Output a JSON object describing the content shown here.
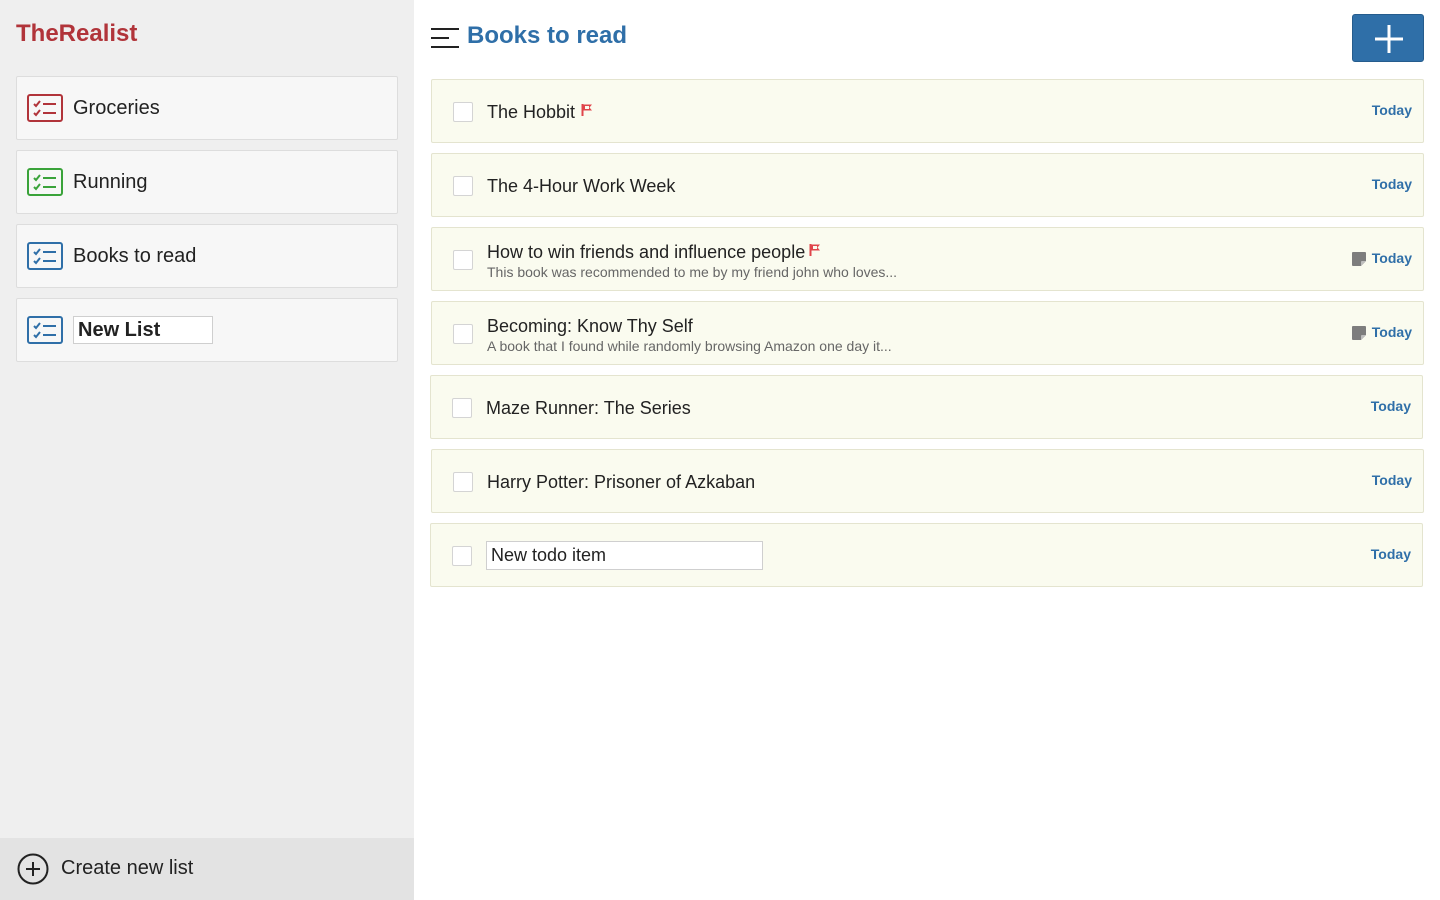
{
  "app": {
    "title": "TheRealist"
  },
  "sidebar": {
    "lists": [
      {
        "label": "Groceries",
        "icon": "checklist-icon",
        "color": "#b1343a"
      },
      {
        "label": "Running",
        "icon": "checklist-icon",
        "color": "#3aa33a"
      },
      {
        "label": "Books to read",
        "icon": "checklist-icon",
        "color": "#2f6fa8"
      }
    ],
    "new_list": {
      "value": "New List",
      "icon": "checklist-icon",
      "color": "#2f6fa8"
    },
    "create_label": "Create new list"
  },
  "main": {
    "title": "Books to read",
    "todos": [
      {
        "title": "The Hobbit",
        "flagged": true,
        "note": "",
        "has_note": false,
        "due": "Today"
      },
      {
        "title": "The 4-Hour Work Week",
        "flagged": false,
        "note": "",
        "has_note": false,
        "due": "Today"
      },
      {
        "title": "How to win friends and influence people",
        "flagged": true,
        "note": "This book was recommended to me by my friend john who loves...",
        "has_note": true,
        "due": "Today"
      },
      {
        "title": "Becoming: Know Thy Self",
        "flagged": false,
        "note": "A book that I found while randomly browsing Amazon one day it...",
        "has_note": true,
        "due": "Today"
      },
      {
        "title": "Maze Runner: The Series",
        "flagged": false,
        "note": "",
        "has_note": false,
        "due": "Today"
      },
      {
        "title": "Harry Potter: Prisoner of Azkaban",
        "flagged": false,
        "note": "",
        "has_note": false,
        "due": "Today"
      }
    ],
    "new_todo": {
      "value": "New todo item",
      "due": "Today"
    }
  },
  "colors": {
    "accent": "#2f6fa8",
    "brand": "#b1343a",
    "flag": "#e0454b",
    "todo_bg": "#fafbef"
  }
}
